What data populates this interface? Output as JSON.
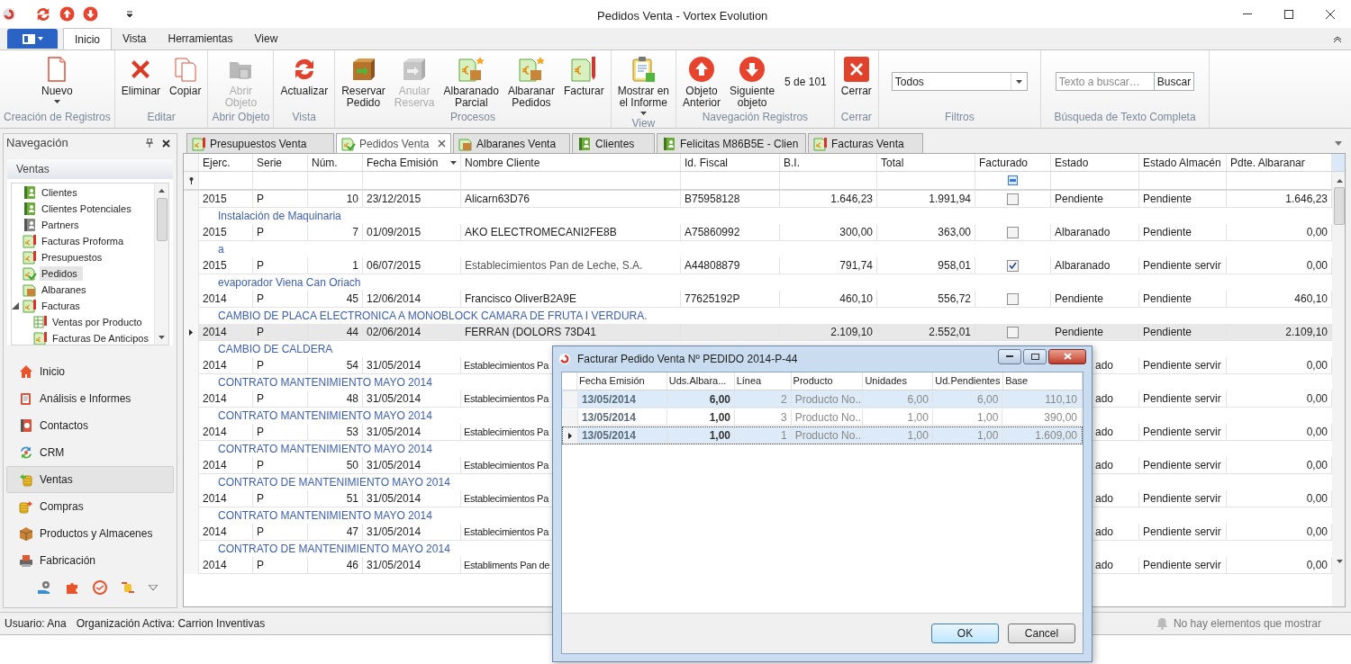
{
  "window": {
    "title": "Pedidos Venta - Vortex Evolution"
  },
  "ribbon_tabs": [
    {
      "label": "Inicio",
      "selected": true
    },
    {
      "label": "Vista",
      "selected": false
    },
    {
      "label": "Herramientas",
      "selected": false
    },
    {
      "label": "View",
      "selected": false
    }
  ],
  "ribbon_groups": [
    {
      "label": "Creación de Registros",
      "items": [
        {
          "kind": "button",
          "label": "Nuevo",
          "disabled": false,
          "dropdown": true
        }
      ]
    },
    {
      "label": "Editar",
      "items": [
        {
          "kind": "button",
          "label": "Eliminar",
          "disabled": false,
          "dropdown": false
        },
        {
          "kind": "button",
          "label": "Copiar",
          "disabled": false,
          "dropdown": false
        }
      ]
    },
    {
      "label": "Abrir Objeto",
      "items": [
        {
          "kind": "button",
          "label": "Abrir\nObjeto",
          "disabled": true,
          "dropdown": false
        }
      ]
    },
    {
      "label": "Vista",
      "items": [
        {
          "kind": "button",
          "label": "Actualizar",
          "disabled": false,
          "dropdown": false
        }
      ]
    },
    {
      "label": "Procesos",
      "items": [
        {
          "kind": "button",
          "label": "Reservar\nPedido",
          "disabled": false,
          "dropdown": false
        },
        {
          "kind": "button",
          "label": "Anular\nReserva",
          "disabled": true,
          "dropdown": false
        },
        {
          "kind": "button",
          "label": "Albaranado\nParcial",
          "disabled": false,
          "dropdown": false
        },
        {
          "kind": "button",
          "label": "Albaranar\nPedidos",
          "disabled": false,
          "dropdown": false
        },
        {
          "kind": "button",
          "label": "Facturar",
          "disabled": false,
          "dropdown": false
        }
      ]
    },
    {
      "label": "View",
      "items": [
        {
          "kind": "button",
          "label": "Mostrar en\nel Informe",
          "disabled": false,
          "dropdown": true
        }
      ]
    },
    {
      "label": "Navegación Registros",
      "items": [
        {
          "kind": "button",
          "label": "Objeto\nAnterior",
          "disabled": false,
          "dropdown": false
        },
        {
          "kind": "button",
          "label": "Siguiente\nobjeto",
          "disabled": false,
          "dropdown": false
        },
        {
          "kind": "counter",
          "label": "5 de 101"
        }
      ]
    },
    {
      "label": "Cerrar",
      "items": [
        {
          "kind": "button",
          "label": "Cerrar",
          "disabled": false,
          "dropdown": false
        }
      ]
    },
    {
      "label": "Filtros",
      "items": [
        {
          "kind": "select",
          "value": "Todos"
        }
      ]
    },
    {
      "label": "Búsqueda de Texto Completa",
      "items": [
        {
          "kind": "search",
          "placeholder": "Texto a buscar…",
          "button": "Buscar"
        }
      ]
    }
  ],
  "navigation": {
    "title": "Navegación",
    "group": "Ventas",
    "tree": [
      {
        "label": "Clientes",
        "selected": false
      },
      {
        "label": "Clientes Potenciales",
        "selected": false
      },
      {
        "label": "Partners",
        "selected": false
      },
      {
        "label": "Facturas Proforma",
        "selected": false
      },
      {
        "label": "Presupuestos",
        "selected": false
      },
      {
        "label": "Pedidos",
        "selected": true
      },
      {
        "label": "Albaranes",
        "selected": false
      },
      {
        "label": "Facturas",
        "selected": false,
        "expanded": true,
        "children": [
          {
            "label": "Ventas por Producto",
            "selected": false
          },
          {
            "label": "Facturas De Anticipos",
            "selected": false
          }
        ]
      }
    ],
    "buttons": [
      {
        "label": "Inicio",
        "selected": false
      },
      {
        "label": "Análisis e Informes",
        "selected": false
      },
      {
        "label": "Contactos",
        "selected": false
      },
      {
        "label": "CRM",
        "selected": false
      },
      {
        "label": "Ventas",
        "selected": true
      },
      {
        "label": "Compras",
        "selected": false
      },
      {
        "label": "Productos y Almacenes",
        "selected": false
      },
      {
        "label": "Fabricación",
        "selected": false
      }
    ]
  },
  "doc_tabs": [
    {
      "label": "Presupuestos Venta",
      "selected": false
    },
    {
      "label": "Pedidos Venta",
      "selected": true
    },
    {
      "label": "Albaranes Venta",
      "selected": false
    },
    {
      "label": "Clientes",
      "selected": false
    },
    {
      "label": "Felicitas M86B5E - Clien",
      "selected": false
    },
    {
      "label": "Facturas Venta",
      "selected": false
    }
  ],
  "table": {
    "filter_row": {
      "facturado_indeterminate": true
    },
    "columns": [
      "Ejerc.",
      "Serie",
      "Núm.",
      "Fecha Emisión",
      "Nombre Cliente",
      "Id. Fiscal",
      "B.I.",
      "Total",
      "Facturado",
      "Estado",
      "Estado Almacén",
      "Pdte. Albaranar"
    ],
    "rows": [
      {
        "ejerc": "2015",
        "serie": "P",
        "num": "10",
        "fecha": "23/12/2015",
        "nombre": "Alicarn63D76",
        "id_fiscal": "B75958128",
        "bi": "1.646,23",
        "total": "1.991,94",
        "facturado": false,
        "estado": "Pendiente",
        "estado_almacen": "Pendiente",
        "pdte_albaranar": "1.646,23",
        "note": "Instalación de Maquinaria",
        "selected": false,
        "covered": false
      },
      {
        "ejerc": "2015",
        "serie": "P",
        "num": "7",
        "fecha": "01/09/2015",
        "nombre": "AKO ELECTROMECANI2FE8B",
        "id_fiscal": "A75860992",
        "bi": "300,00",
        "total": "363,00",
        "facturado": false,
        "estado": "Albaranado",
        "estado_almacen": "Pendiente",
        "pdte_albaranar": "0,00",
        "note": "a",
        "selected": false,
        "covered": false
      },
      {
        "ejerc": "2015",
        "serie": "P",
        "num": "1",
        "fecha": "06/07/2015",
        "nombre": "Establecimientos Pan de Leche, S.A.",
        "id_fiscal": "A44808879",
        "bi": "791,74",
        "total": "958,01",
        "facturado": true,
        "estado": "Albaranado",
        "estado_almacen": "Pendiente servir",
        "pdte_albaranar": "0,00",
        "note": "evaporador Viena Can Oriach",
        "selected": false,
        "covered": false
      },
      {
        "ejerc": "2014",
        "serie": "P",
        "num": "45",
        "fecha": "12/06/2014",
        "nombre": "Francisco OliverB2A9E",
        "id_fiscal": "77625192P",
        "bi": "460,10",
        "total": "556,72",
        "facturado": false,
        "estado": "Pendiente",
        "estado_almacen": "Pendiente",
        "pdte_albaranar": "460,10",
        "note": "CAMBIO DE PLACA ELECTRONICA A MONOBLOCK CAMARA DE FRUTA I VERDURA.",
        "selected": false,
        "covered": false
      },
      {
        "ejerc": "2014",
        "serie": "P",
        "num": "44",
        "fecha": "02/06/2014",
        "nombre": "FERRAN (DOLORS 73D41",
        "bi": "2.109,10",
        "total": "2.552,01",
        "facturado": false,
        "estado": "Pendiente",
        "estado_almacen": "Pendiente",
        "pdte_albaranar": "2.109,10",
        "note": "CAMBIO DE CALDERA",
        "selected": true,
        "covered": false
      },
      {
        "ejerc": "2014",
        "serie": "P",
        "num": "54",
        "fecha": "31/05/2014",
        "nombre": "Establecimientos Pa",
        "estado": "ado",
        "estado_almacen": "Pendiente servir",
        "pdte_albaranar": "0,00",
        "note": "CONTRATO MANTENIMIENTO MAYO 2014",
        "selected": false,
        "covered": true
      },
      {
        "ejerc": "2014",
        "serie": "P",
        "num": "48",
        "fecha": "31/05/2014",
        "nombre": "Establecimientos Pa",
        "estado": "ado",
        "estado_almacen": "Pendiente servir",
        "pdte_albaranar": "0,00",
        "note": "CONTRATO MANTENIMIENTO MAYO 2014",
        "selected": false,
        "covered": true
      },
      {
        "ejerc": "2014",
        "serie": "P",
        "num": "53",
        "fecha": "31/05/2014",
        "nombre": "Establecimientos Pa",
        "estado": "ado",
        "estado_almacen": "Pendiente servir",
        "pdte_albaranar": "0,00",
        "note": "CONTRATO MANTENIMIENTO MAYO 2014",
        "selected": false,
        "covered": true
      },
      {
        "ejerc": "2014",
        "serie": "P",
        "num": "50",
        "fecha": "31/05/2014",
        "nombre": "Establecimientos Pa",
        "estado": "ado",
        "estado_almacen": "Pendiente servir",
        "pdte_albaranar": "0,00",
        "note": "CONTRATO DE MANTENIMIENTO MAYO 2014",
        "selected": false,
        "covered": true
      },
      {
        "ejerc": "2014",
        "serie": "P",
        "num": "51",
        "fecha": "31/05/2014",
        "nombre": "Establecimientos Pa",
        "estado": "ado",
        "estado_almacen": "Pendiente servir",
        "pdte_albaranar": "0,00",
        "note": "CONTRATO MANTENIMIENTO MAYO 2014",
        "selected": false,
        "covered": true
      },
      {
        "ejerc": "2014",
        "serie": "P",
        "num": "47",
        "fecha": "31/05/2014",
        "nombre": "Establecimientos Pa",
        "estado": "ado",
        "estado_almacen": "Pendiente servir",
        "pdte_albaranar": "0,00",
        "note": "CONTRATO DE MANTENIMIENTO MAYO 2014",
        "selected": false,
        "covered": true
      },
      {
        "ejerc": "2014",
        "serie": "P",
        "num": "46",
        "fecha": "31/05/2014",
        "nombre": "Establiments Pan de",
        "estado": "ado",
        "estado_almacen": "Pendiente servir",
        "pdte_albaranar": "0,00",
        "selected": false,
        "covered": true
      }
    ]
  },
  "dialog": {
    "title": "Facturar Pedido Venta Nº PEDIDO 2014-P-44",
    "columns": [
      "Fecha Emisión",
      "Uds.Albara...",
      "Línea",
      "Producto",
      "Unidades",
      "Ud.Pendientes",
      "Base"
    ],
    "rows": [
      {
        "fecha": "13/05/2014",
        "uds": "6,00",
        "linea": "2",
        "producto": "Producto No...",
        "unidades": "6,00",
        "ud_pendientes": "6,00",
        "base": "110,10",
        "selected": true,
        "focused": false
      },
      {
        "fecha": "13/05/2014",
        "uds": "1,00",
        "linea": "3",
        "producto": "Producto No...",
        "unidades": "1,00",
        "ud_pendientes": "1,00",
        "base": "390,00",
        "selected": false,
        "focused": false
      },
      {
        "fecha": "13/05/2014",
        "uds": "1,00",
        "linea": "1",
        "producto": "Producto No...",
        "unidades": "1,00",
        "ud_pendientes": "1,00",
        "base": "1.609,00",
        "selected": true,
        "focused": true
      }
    ],
    "buttons": [
      "OK",
      "Cancel"
    ]
  },
  "status_bar": {
    "user": "Usuario: Ana",
    "organization": "Organización Activa: Carrion Inventivas",
    "notifications": "No hay elementos que mostrar"
  }
}
